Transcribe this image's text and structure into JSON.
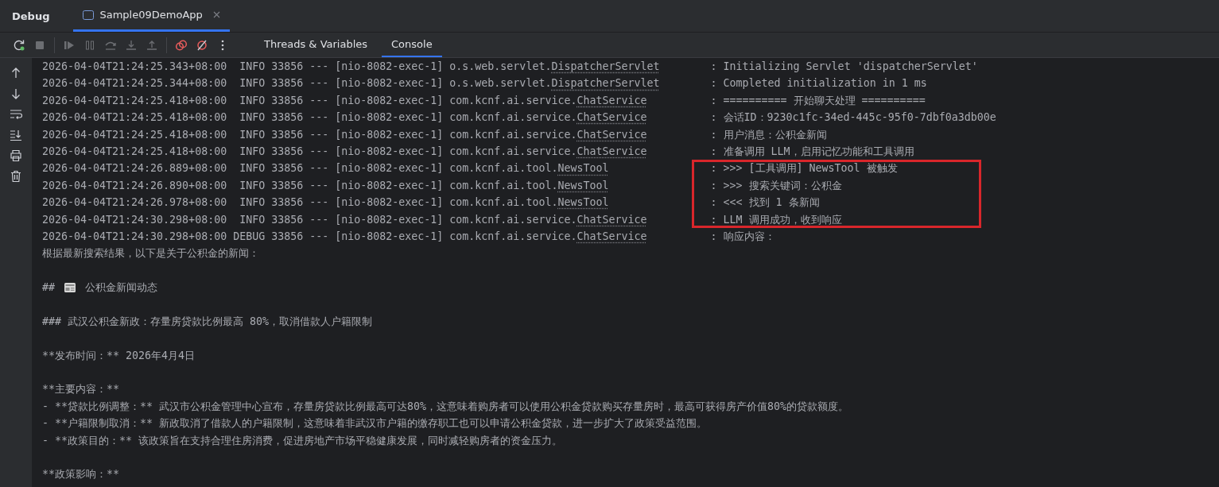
{
  "header": {
    "title": "Debug",
    "tabs": [
      {
        "label": "Sample09DemoApp",
        "selected": true
      }
    ]
  },
  "toolbar": {
    "buttons": [
      {
        "kind": "rerun",
        "disabled": false
      },
      {
        "kind": "stop",
        "disabled": true
      },
      {
        "kind": "separator"
      },
      {
        "kind": "resume",
        "disabled": true
      },
      {
        "kind": "pause",
        "disabled": true
      },
      {
        "kind": "step-over",
        "disabled": true
      },
      {
        "kind": "step-into",
        "disabled": true
      },
      {
        "kind": "step-out",
        "disabled": true
      },
      {
        "kind": "separator"
      },
      {
        "kind": "breakpoints",
        "disabled": false
      },
      {
        "kind": "mute",
        "disabled": false
      },
      {
        "kind": "more",
        "disabled": false
      }
    ],
    "tabs": [
      {
        "label": "Threads & Variables",
        "selected": false
      },
      {
        "label": "Console",
        "selected": true
      }
    ]
  },
  "gutter": [
    {
      "kind": "up"
    },
    {
      "kind": "down"
    },
    {
      "kind": "wrap"
    },
    {
      "kind": "scroll-end"
    },
    {
      "kind": "print"
    },
    {
      "kind": "trash"
    }
  ],
  "log": [
    {
      "time": "2026-04-04T21:24:25.343+08:00",
      "level": "INFO",
      "process": "33856 --- [nio-8082-exec-1]",
      "logger_package": "o.s.web.servlet.",
      "logger_class": "DispatcherServlet",
      "message": ": Initializing Servlet 'dispatcherServlet'",
      "highlighted": false
    },
    {
      "time": "2026-04-04T21:24:25.344+08:00",
      "level": "INFO",
      "process": "33856 --- [nio-8082-exec-1]",
      "logger_package": "o.s.web.servlet.",
      "logger_class": "DispatcherServlet",
      "message": ": Completed initialization in 1 ms",
      "highlighted": false
    },
    {
      "time": "2026-04-04T21:24:25.418+08:00",
      "level": "INFO",
      "process": "33856 --- [nio-8082-exec-1]",
      "logger_package": "com.kcnf.ai.service.",
      "logger_class": "ChatService",
      "message": ": ========== 开始聊天处理 ==========",
      "highlighted": false
    },
    {
      "time": "2026-04-04T21:24:25.418+08:00",
      "level": "INFO",
      "process": "33856 --- [nio-8082-exec-1]",
      "logger_package": "com.kcnf.ai.service.",
      "logger_class": "ChatService",
      "message": ": 会话ID：9230c1fc-34ed-445c-95f0-7dbf0a3db00e",
      "highlighted": false
    },
    {
      "time": "2026-04-04T21:24:25.418+08:00",
      "level": "INFO",
      "process": "33856 --- [nio-8082-exec-1]",
      "logger_package": "com.kcnf.ai.service.",
      "logger_class": "ChatService",
      "message": ": 用户消息：公积金新闻",
      "highlighted": false
    },
    {
      "time": "2026-04-04T21:24:25.418+08:00",
      "level": "INFO",
      "process": "33856 --- [nio-8082-exec-1]",
      "logger_package": "com.kcnf.ai.service.",
      "logger_class": "ChatService",
      "message": ": 准备调用 LLM，启用记忆功能和工具调用",
      "highlighted": false
    },
    {
      "time": "2026-04-04T21:24:26.889+08:00",
      "level": "INFO",
      "process": "33856 --- [nio-8082-exec-1]",
      "logger_package": "com.kcnf.ai.tool.",
      "logger_class": "NewsTool",
      "message": ": >>> [工具调用] NewsTool 被触发",
      "highlighted": true
    },
    {
      "time": "2026-04-04T21:24:26.890+08:00",
      "level": "INFO",
      "process": "33856 --- [nio-8082-exec-1]",
      "logger_package": "com.kcnf.ai.tool.",
      "logger_class": "NewsTool",
      "message": ": >>> 搜索关键词：公积金",
      "highlighted": true
    },
    {
      "time": "2026-04-04T21:24:26.978+08:00",
      "level": "INFO",
      "process": "33856 --- [nio-8082-exec-1]",
      "logger_package": "com.kcnf.ai.tool.",
      "logger_class": "NewsTool",
      "message": ": <<< 找到 1 条新闻",
      "highlighted": true
    },
    {
      "time": "2026-04-04T21:24:30.298+08:00",
      "level": "INFO",
      "process": "33856 --- [nio-8082-exec-1]",
      "logger_package": "com.kcnf.ai.service.",
      "logger_class": "ChatService",
      "message": ": LLM 调用成功，收到响应",
      "highlighted": true
    },
    {
      "time": "2026-04-04T21:24:30.298+08:00",
      "level": "DEBUG",
      "process": "33856 --- [nio-8082-exec-1]",
      "logger_package": "com.kcnf.ai.service.",
      "logger_class": "ChatService",
      "message": ": 响应内容：",
      "highlighted": false
    }
  ],
  "response": [
    {
      "lines": [
        {
          "kind": "text",
          "text": "根据最新搜索结果，以下是关于公积金的新闻："
        }
      ]
    },
    {
      "lines": [
        {
          "kind": "icon-heading",
          "marker": "##",
          "text": "公积金新闻动态"
        }
      ]
    },
    {
      "lines": [
        {
          "kind": "text",
          "text": "### 武汉公积金新政：存量房贷款比例最高 80%，取消借款人户籍限制"
        }
      ]
    },
    {
      "lines": [
        {
          "kind": "text",
          "text": "**发布时间：** 2026年4月4日"
        }
      ]
    },
    {
      "lines": [
        {
          "kind": "text",
          "text": "**主要内容：**"
        },
        {
          "kind": "text",
          "text": "- **贷款比例调整：** 武汉市公积金管理中心宣布，存量房贷款比例最高可达80%，这意味着购房者可以使用公积金贷款购买存量房时，最高可获得房产价值80%的贷款额度。"
        },
        {
          "kind": "text",
          "text": "- **户籍限制取消：** 新政取消了借款人的户籍限制，这意味着非武汉市户籍的缴存职工也可以申请公积金贷款，进一步扩大了政策受益范围。"
        },
        {
          "kind": "text",
          "text": "- **政策目的：** 该政策旨在支持合理住房消费，促进房地产市场平稳健康发展，同时减轻购房者的资金压力。"
        }
      ]
    },
    {
      "lines": [
        {
          "kind": "text",
          "text": "**政策影响：**"
        }
      ]
    }
  ]
}
